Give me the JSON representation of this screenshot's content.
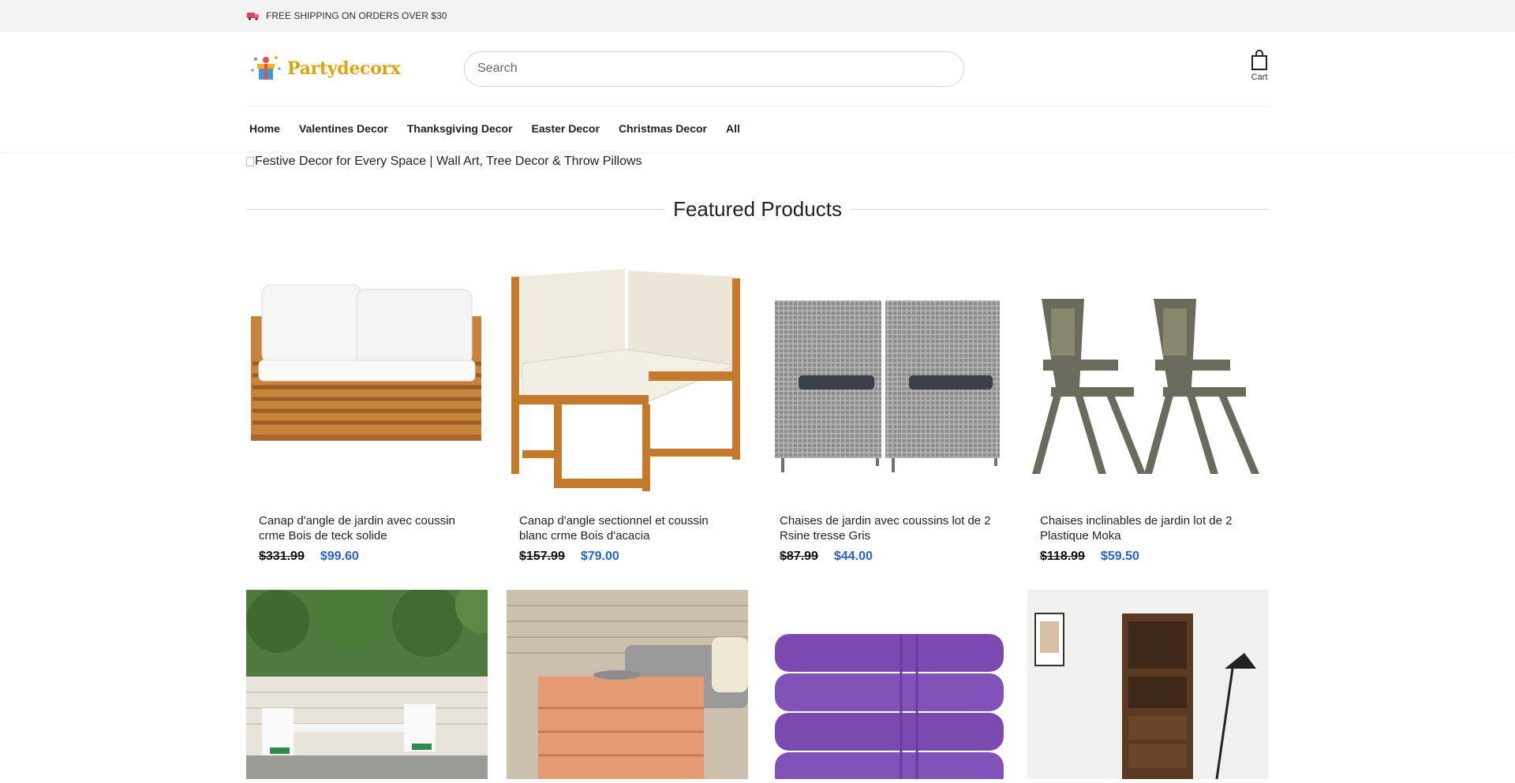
{
  "announcement": {
    "text": "FREE SHIPPING ON ORDERS OVER $30",
    "icon": "truck-icon"
  },
  "header": {
    "logo_text": "Partydecorx",
    "search_placeholder": "Search",
    "cart_label": "Cart"
  },
  "nav": {
    "items": [
      {
        "label": "Home"
      },
      {
        "label": "Valentines Decor"
      },
      {
        "label": "Thanksgiving Decor"
      },
      {
        "label": "Easter Decor"
      },
      {
        "label": "Christmas Decor"
      },
      {
        "label": "All"
      }
    ]
  },
  "hero": {
    "alt_text": "Festive Decor for Every Space | Wall Art, Tree Decor & Throw Pillows"
  },
  "featured": {
    "title": "Featured Products"
  },
  "products": [
    {
      "title": "Canap d'angle de jardin avec coussin crme Bois de teck solide",
      "old_price": "$331.99",
      "new_price": "$99.60"
    },
    {
      "title": "Canap d'angle sectionnel et coussin blanc crme Bois d'acacia",
      "old_price": "$157.99",
      "new_price": "$79.00"
    },
    {
      "title": "Chaises de jardin avec coussins lot de 2 Rsine tresse Gris",
      "old_price": "$87.99",
      "new_price": "$44.00"
    },
    {
      "title": "Chaises inclinables de jardin lot de 2 Plastique Moka",
      "old_price": "$118.99",
      "new_price": "$59.50"
    }
  ],
  "colors": {
    "accent_price": "#2563c9",
    "logo": "#d9a514",
    "announce_bg": "#f3f3f5"
  }
}
